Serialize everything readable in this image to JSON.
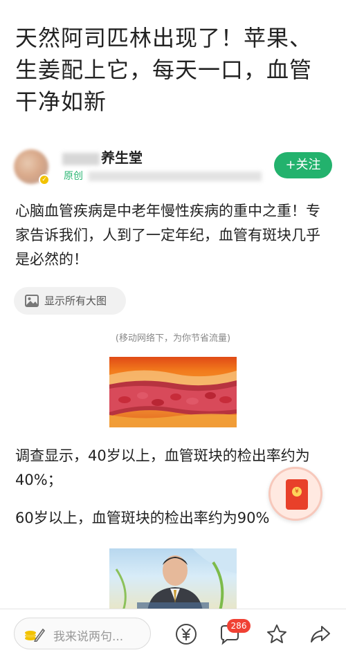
{
  "article": {
    "title": "天然阿司匹林出现了！苹果、生姜配上它，每天一口，血管干净如新",
    "paragraphs": [
      "心脑血管疾病是中老年慢性疾病的重中之重！专家告诉我们，人到了一定年纪，血管有斑块几乎是必然的！",
      "调查显示，40岁以上，血管斑块的检出率约为40%；",
      "60岁以上，血管斑块的检出率约为90%"
    ],
    "show_images_label": "显示所有大图",
    "network_note": "(移动网络下，为你节省流量)"
  },
  "author": {
    "name": "养生堂",
    "tag": "原创",
    "follow_label": "+关注"
  },
  "bottom_bar": {
    "comment_placeholder": "我来说两句...",
    "comment_count": "286"
  },
  "icons": {
    "avatar_badge": "v-badge-icon",
    "show_images": "image-icon",
    "red_packet": "red-packet-icon",
    "edit": "edit-icon",
    "coin": "coin-icon",
    "comment": "comment-icon",
    "favorite": "star-icon",
    "share": "share-icon"
  },
  "colors": {
    "accent_green": "#23b26d",
    "badge_red": "#f04134",
    "red_packet": "#e8402a"
  }
}
